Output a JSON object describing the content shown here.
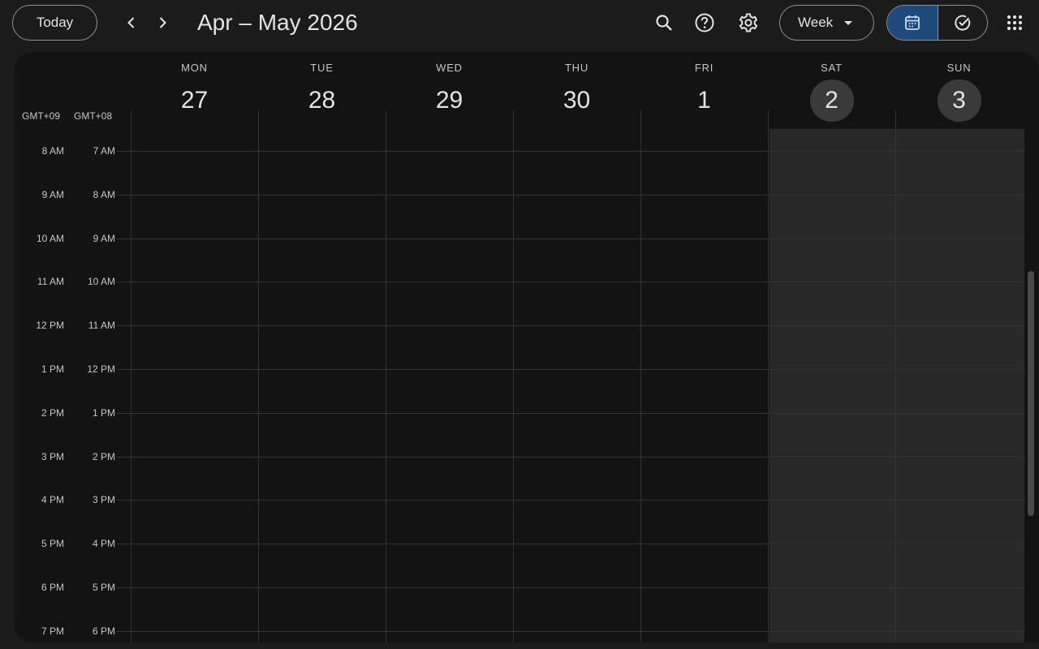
{
  "toolbar": {
    "today_label": "Today",
    "prev_icon": "chevron-left-icon",
    "next_icon": "chevron-right-icon",
    "title": "Apr – May 2026",
    "search_icon": "search-icon",
    "help_icon": "help-icon",
    "settings_icon": "gear-icon",
    "view_label": "Week",
    "calendar_toggle_icon": "calendar-icon",
    "tasks_toggle_icon": "tasks-check-icon",
    "apps_icon": "apps-grid-icon"
  },
  "timezones": [
    "GMT+09",
    "GMT+08"
  ],
  "days": [
    {
      "name": "MON",
      "num": "27",
      "weekend": false
    },
    {
      "name": "TUE",
      "num": "28",
      "weekend": false
    },
    {
      "name": "WED",
      "num": "29",
      "weekend": false
    },
    {
      "name": "THU",
      "num": "30",
      "weekend": false
    },
    {
      "name": "FRI",
      "num": "1",
      "weekend": false
    },
    {
      "name": "SAT",
      "num": "2",
      "weekend": true
    },
    {
      "name": "SUN",
      "num": "3",
      "weekend": true
    }
  ],
  "hours": [
    {
      "primary": "8 AM",
      "secondary": "7 AM"
    },
    {
      "primary": "9 AM",
      "secondary": "8 AM"
    },
    {
      "primary": "10 AM",
      "secondary": "9 AM"
    },
    {
      "primary": "11 AM",
      "secondary": "10 AM"
    },
    {
      "primary": "12 PM",
      "secondary": "11 AM"
    },
    {
      "primary": "1 PM",
      "secondary": "12 PM"
    },
    {
      "primary": "2 PM",
      "secondary": "1 PM"
    },
    {
      "primary": "3 PM",
      "secondary": "2 PM"
    },
    {
      "primary": "4 PM",
      "secondary": "3 PM"
    },
    {
      "primary": "5 PM",
      "secondary": "4 PM"
    },
    {
      "primary": "6 PM",
      "secondary": "5 PM"
    },
    {
      "primary": "7 PM",
      "secondary": "6 PM"
    }
  ],
  "colors": {
    "accent": "#1f4a7c",
    "background": "#1b1b1b",
    "grid_background": "#131313",
    "weekend_shade": "#292929"
  }
}
